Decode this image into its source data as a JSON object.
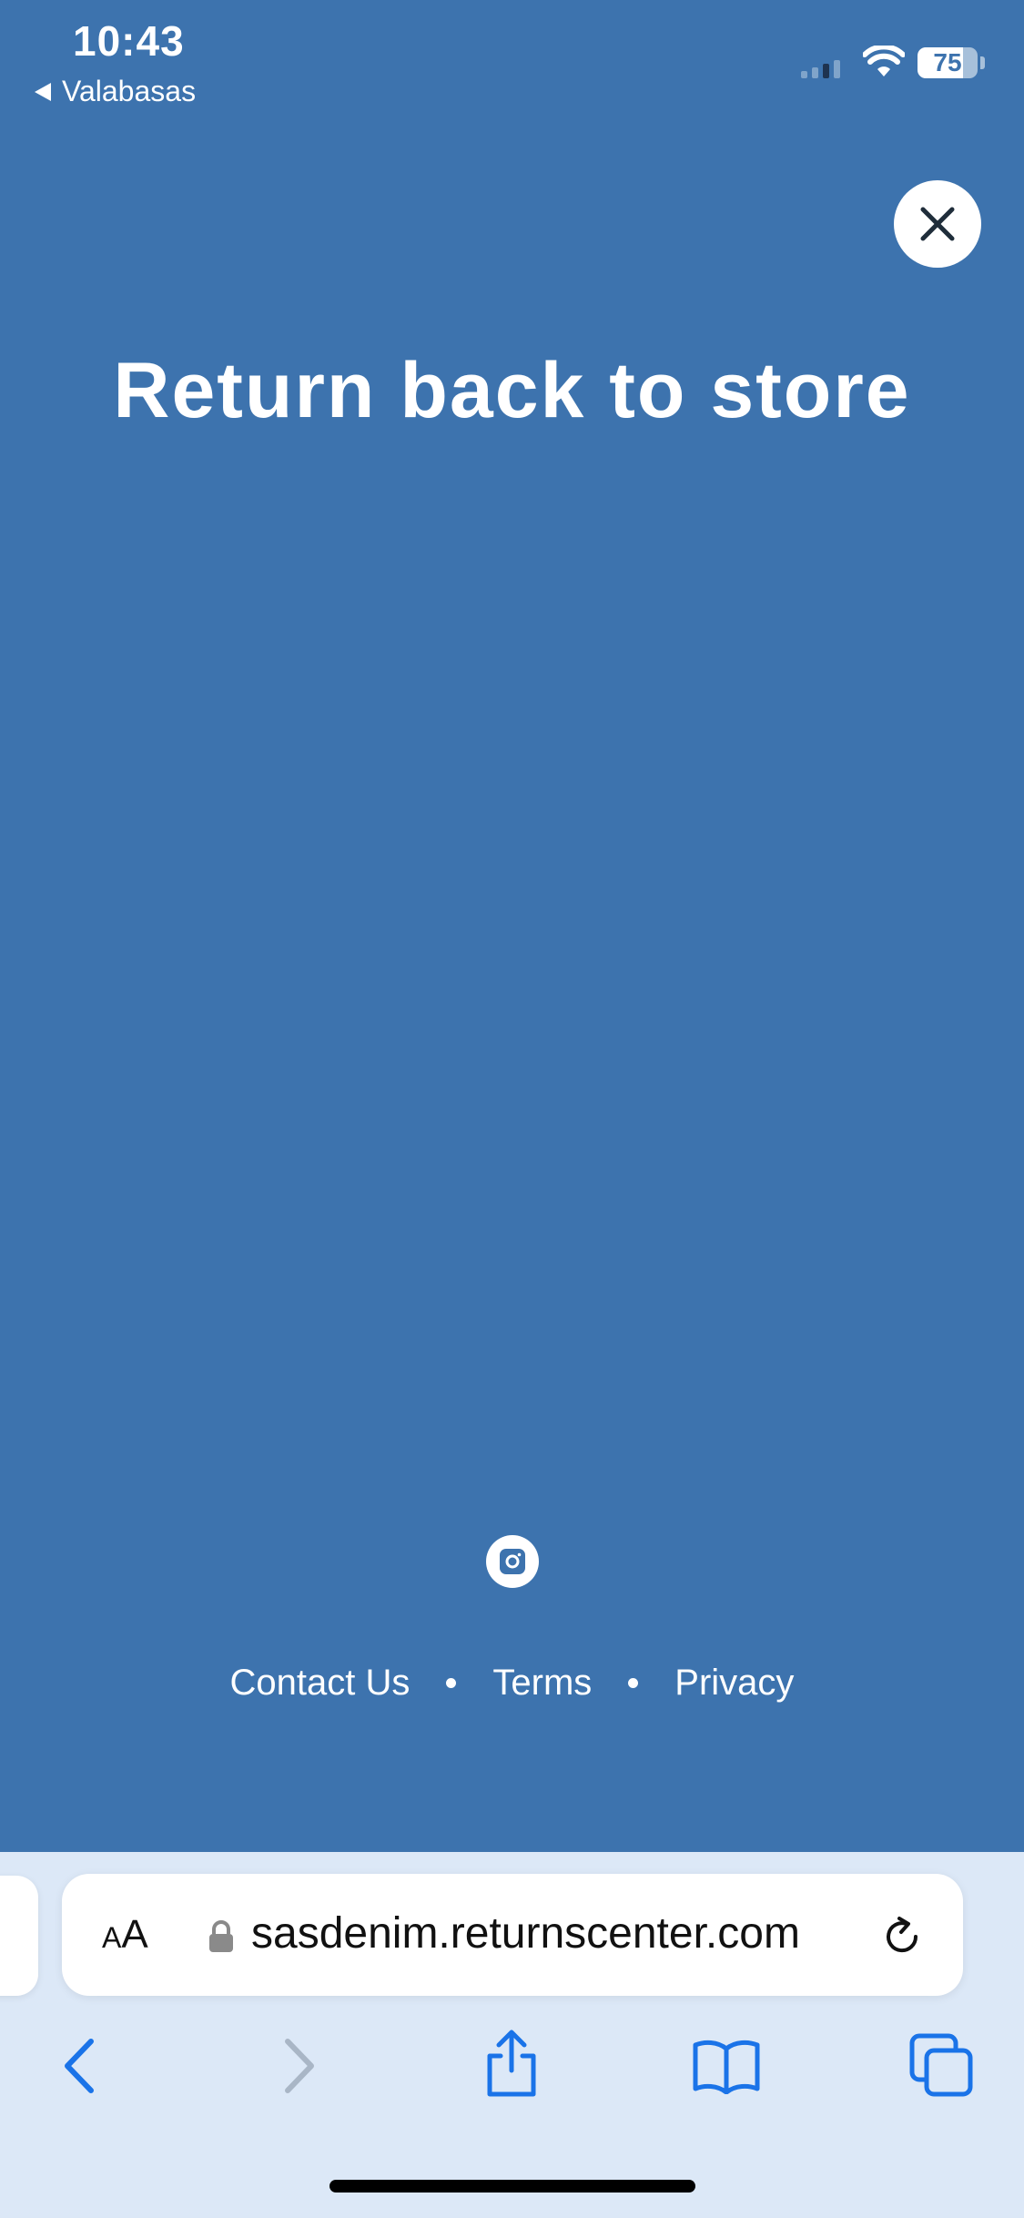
{
  "status_bar": {
    "time": "10:43",
    "back_app": "Valabasas",
    "battery": "75"
  },
  "page": {
    "title": "Return back to store",
    "close_icon": "close-icon",
    "instagram_icon": "instagram-icon"
  },
  "footer": {
    "links": [
      "Contact Us",
      "Terms",
      "Privacy"
    ]
  },
  "browser": {
    "aa_small": "A",
    "aa_large": "A",
    "url": "sasdenim.returnscenter.com"
  },
  "colors": {
    "background": "#3d73ae",
    "toolbar": "#dce8f7",
    "accent": "#1a73e8"
  }
}
